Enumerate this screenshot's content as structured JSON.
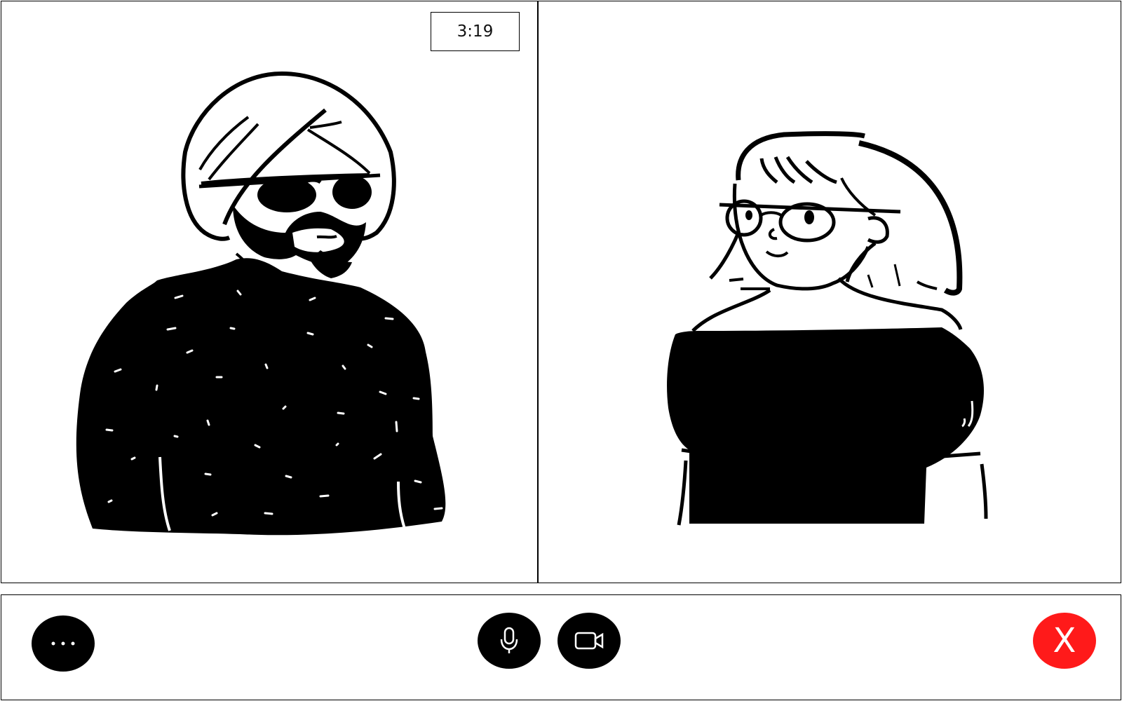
{
  "call": {
    "elapsed_time": "3:19"
  },
  "controls": {
    "more_icon": "more-options-icon",
    "mic_icon": "microphone-icon",
    "camera_icon": "video-camera-icon",
    "end_label": "X",
    "end_color": "#ff1a1a",
    "button_color": "#000000"
  }
}
